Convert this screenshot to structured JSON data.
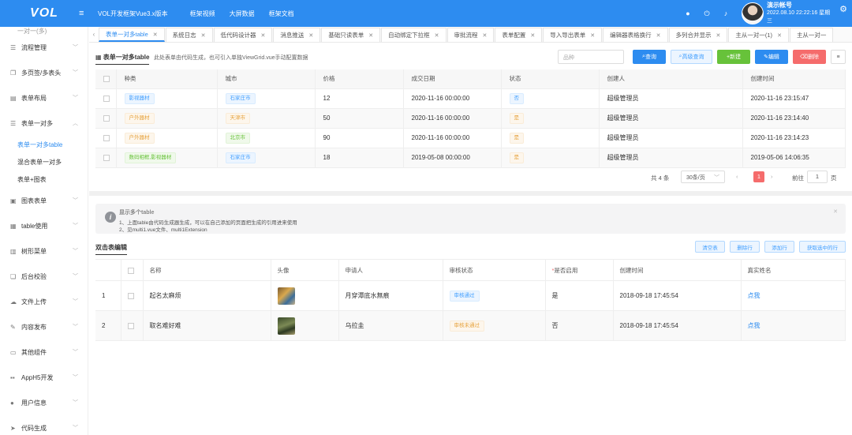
{
  "header": {
    "logo": "VOL",
    "app_title": "VOL开发框架Vue3.x版本",
    "nav": [
      "框架视频",
      "大屏数据",
      "框架文档"
    ],
    "user_name": "演示帐号",
    "user_date": "2022.08.10 22:22:16 星期三"
  },
  "sidebar": {
    "cut_item": "一对一(多)",
    "items": [
      {
        "label": "流程管理",
        "icon": "sliders-icon"
      },
      {
        "label": "多页签/多表头",
        "icon": "copy-icon"
      },
      {
        "label": "表单布局",
        "icon": "doc-icon"
      },
      {
        "label": "表单一对多",
        "icon": "sliders-icon"
      }
    ],
    "sub_items": [
      "表单一对多table",
      "混合表单一对多",
      "表单+图表"
    ],
    "items_after": [
      {
        "label": "图表表单",
        "icon": "chart-icon"
      },
      {
        "label": "table使用",
        "icon": "table-icon"
      },
      {
        "label": "树形菜单",
        "icon": "tree-icon"
      },
      {
        "label": "后台校验",
        "icon": "check-icon"
      },
      {
        "label": "文件上传",
        "icon": "cloud-icon"
      },
      {
        "label": "内容发布",
        "icon": "edit-icon"
      },
      {
        "label": "其他组件",
        "icon": "folder-icon"
      },
      {
        "label": "AppH5开发",
        "icon": "grid-icon"
      },
      {
        "label": "用户信息",
        "icon": "user-icon"
      },
      {
        "label": "代码生成",
        "icon": "send-icon"
      }
    ]
  },
  "tabs": [
    "表单一对多table",
    "系统日志",
    "低代码设计器",
    "消息推送",
    "基础只读表单",
    "自动绑定下拉框",
    "审批流程",
    "表单配置",
    "导入导出表单",
    "编辑器表格换行",
    "多列合并显示",
    "主从一对一(1)",
    "主从一对一"
  ],
  "table1": {
    "title": "表单一对多table",
    "desc": "此处表单由代码生成，也可引入单独ViewGrid.vue手动配置数据",
    "search_placeholder": "品种",
    "buttons": {
      "query": "查询",
      "advanced": "高级查询",
      "add": "新建",
      "edit": "编辑",
      "delete": "删除"
    },
    "columns": [
      "种类",
      "城市",
      "价格",
      "成交日期",
      "状态",
      "创建人",
      "创建时间"
    ],
    "rows": [
      {
        "type": "影视器材",
        "type_color": "blue",
        "city": "石家庄市",
        "city_color": "blue",
        "price": "12",
        "date": "2020-11-16 00:00:00",
        "status": "否",
        "status_color": "blue",
        "creator": "超级管理员",
        "created": "2020-11-16 23:15:47"
      },
      {
        "type": "户外器材",
        "type_color": "orange",
        "city": "天津市",
        "city_color": "orange",
        "price": "50",
        "date": "2020-11-16 00:00:00",
        "status": "是",
        "status_color": "orange",
        "creator": "超级管理员",
        "created": "2020-11-16 23:14:40"
      },
      {
        "type": "户外器材",
        "type_color": "orange",
        "city": "北京市",
        "city_color": "green",
        "price": "90",
        "date": "2020-11-16 00:00:00",
        "status": "是",
        "status_color": "orange",
        "creator": "超级管理员",
        "created": "2020-11-16 23:14:23"
      },
      {
        "type": "数码相框,影视器材",
        "type_color": "green",
        "city": "石家庄市",
        "city_color": "blue",
        "price": "18",
        "date": "2019-05-08 00:00:00",
        "status": "是",
        "status_color": "orange",
        "creator": "超级管理员",
        "created": "2019-05-06 14:06:35"
      }
    ],
    "pager": {
      "total": "共 4 条",
      "page_size": "30条/页",
      "current": "1",
      "goto": "前往",
      "goto_value": "1",
      "page_unit": "页"
    }
  },
  "alert": {
    "title": "显示多个table",
    "line1": "1、上面table由代码生成器生成，可以在自己添加的页面把生成的引用进来使用",
    "line2": "2、见multi1.vue文件、multi1Extension"
  },
  "table2": {
    "title": "双击表编辑",
    "buttons": {
      "clear": "清空表",
      "delete_row": "删除行",
      "add_row": "添加行",
      "get_selected": "获取选中的行"
    },
    "columns": [
      "名称",
      "头像",
      "申请人",
      "审核状态",
      "是否启用",
      "创建时间",
      "真实姓名"
    ],
    "rows": [
      {
        "index": "1",
        "name": "起名太麻烦",
        "applicant": "月穿潭底水無痕",
        "audit": "审核通过",
        "audit_color": "blue",
        "enabled": "是",
        "created": "2018-09-18 17:45:54",
        "real_name": "点我"
      },
      {
        "index": "2",
        "name": "取名难好难",
        "applicant": "乌拉圭",
        "audit": "审核未通过",
        "audit_color": "orange",
        "enabled": "否",
        "created": "2018-09-18 17:45:54",
        "real_name": "点我"
      }
    ]
  }
}
